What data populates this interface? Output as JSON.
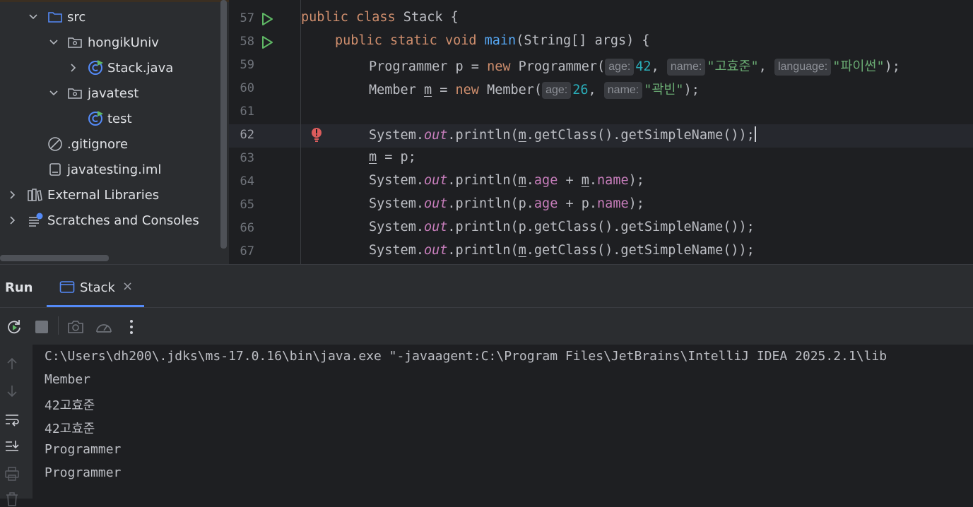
{
  "project_tree": {
    "items": [
      {
        "label": "src",
        "icon": "folder-icon",
        "expanded": true
      },
      {
        "label": "hongikUniv",
        "icon": "package-icon",
        "expanded": true
      },
      {
        "label": "Stack.java",
        "icon": "java-class-icon",
        "expanded": false
      },
      {
        "label": "javatest",
        "icon": "package-icon",
        "expanded": true
      },
      {
        "label": "test",
        "icon": "java-class-icon"
      },
      {
        "label": ".gitignore",
        "icon": "ignore-file-icon"
      },
      {
        "label": "javatesting.iml",
        "icon": "module-file-icon"
      },
      {
        "label": "External Libraries",
        "icon": "libraries-icon",
        "expanded": false
      },
      {
        "label": "Scratches and Consoles",
        "icon": "scratches-icon",
        "expanded": false
      }
    ]
  },
  "editor": {
    "line_numbers": [
      "57",
      "58",
      "59",
      "60",
      "61",
      "62",
      "63",
      "64",
      "65",
      "66",
      "67"
    ],
    "active_line": "62",
    "hints": {
      "age": "age:",
      "name": "name:",
      "language": "language:"
    },
    "lines": {
      "l57": {
        "kw1": "public",
        "kw2": "class",
        "rest": " Stack {"
      },
      "l58": {
        "kw1": "public",
        "kw2": "static",
        "kw3": "void",
        "fn": "main",
        "rest": "(String[] args) {"
      },
      "l59": {
        "a": "Programmer p = ",
        "kw": "new",
        "b": " Programmer(",
        "n": "42",
        "c": ", ",
        "s1": "\"고효준\"",
        "d": ", ",
        "s2": "\"파이썬\"",
        "e": ");"
      },
      "l60": {
        "a": "Member ",
        "v": "m",
        "b": " = ",
        "kw": "new",
        "c": " Member(",
        "n": "26",
        "d": ", ",
        "s1": "\"곽빈\"",
        "e": ");"
      },
      "l62": {
        "a": "System.",
        "out": "out",
        "b": ".println(",
        "v": "m",
        "c": ".getClass().getSimpleName());"
      },
      "l63": {
        "v": "m",
        "a": " = p;"
      },
      "l64": {
        "a": "System.",
        "out": "out",
        "b": ".println(",
        "v1": "m",
        "f1": "age",
        "c": " + ",
        "v2": "m",
        "f2": "name",
        "d": ");"
      },
      "l65": {
        "a": "System.",
        "out": "out",
        "b": ".println(p.",
        "f1": "age",
        "c": " + p.",
        "f2": "name",
        "d": ");"
      },
      "l66": {
        "a": "System.",
        "out": "out",
        "b": ".println(p.getClass().getSimpleName());"
      },
      "l67": {
        "a": "System.",
        "out": "out",
        "b": ".println(",
        "v": "m",
        "c": ".getClass().getSimpleName());"
      }
    }
  },
  "run_panel": {
    "title": "Run",
    "tab_label": "Stack",
    "close_glyph": "×",
    "console_lines": [
      "C:\\Users\\dh200\\.jdks\\ms-17.0.16\\bin\\java.exe \"-javaagent:C:\\Program Files\\JetBrains\\IntelliJ IDEA 2025.2.1\\lib",
      "Member",
      "42고효준",
      "42고효준",
      "Programmer",
      "Programmer"
    ]
  },
  "colors": {
    "accent": "#548af7",
    "run_green": "#5fb865",
    "error_red": "#db5c5c"
  }
}
